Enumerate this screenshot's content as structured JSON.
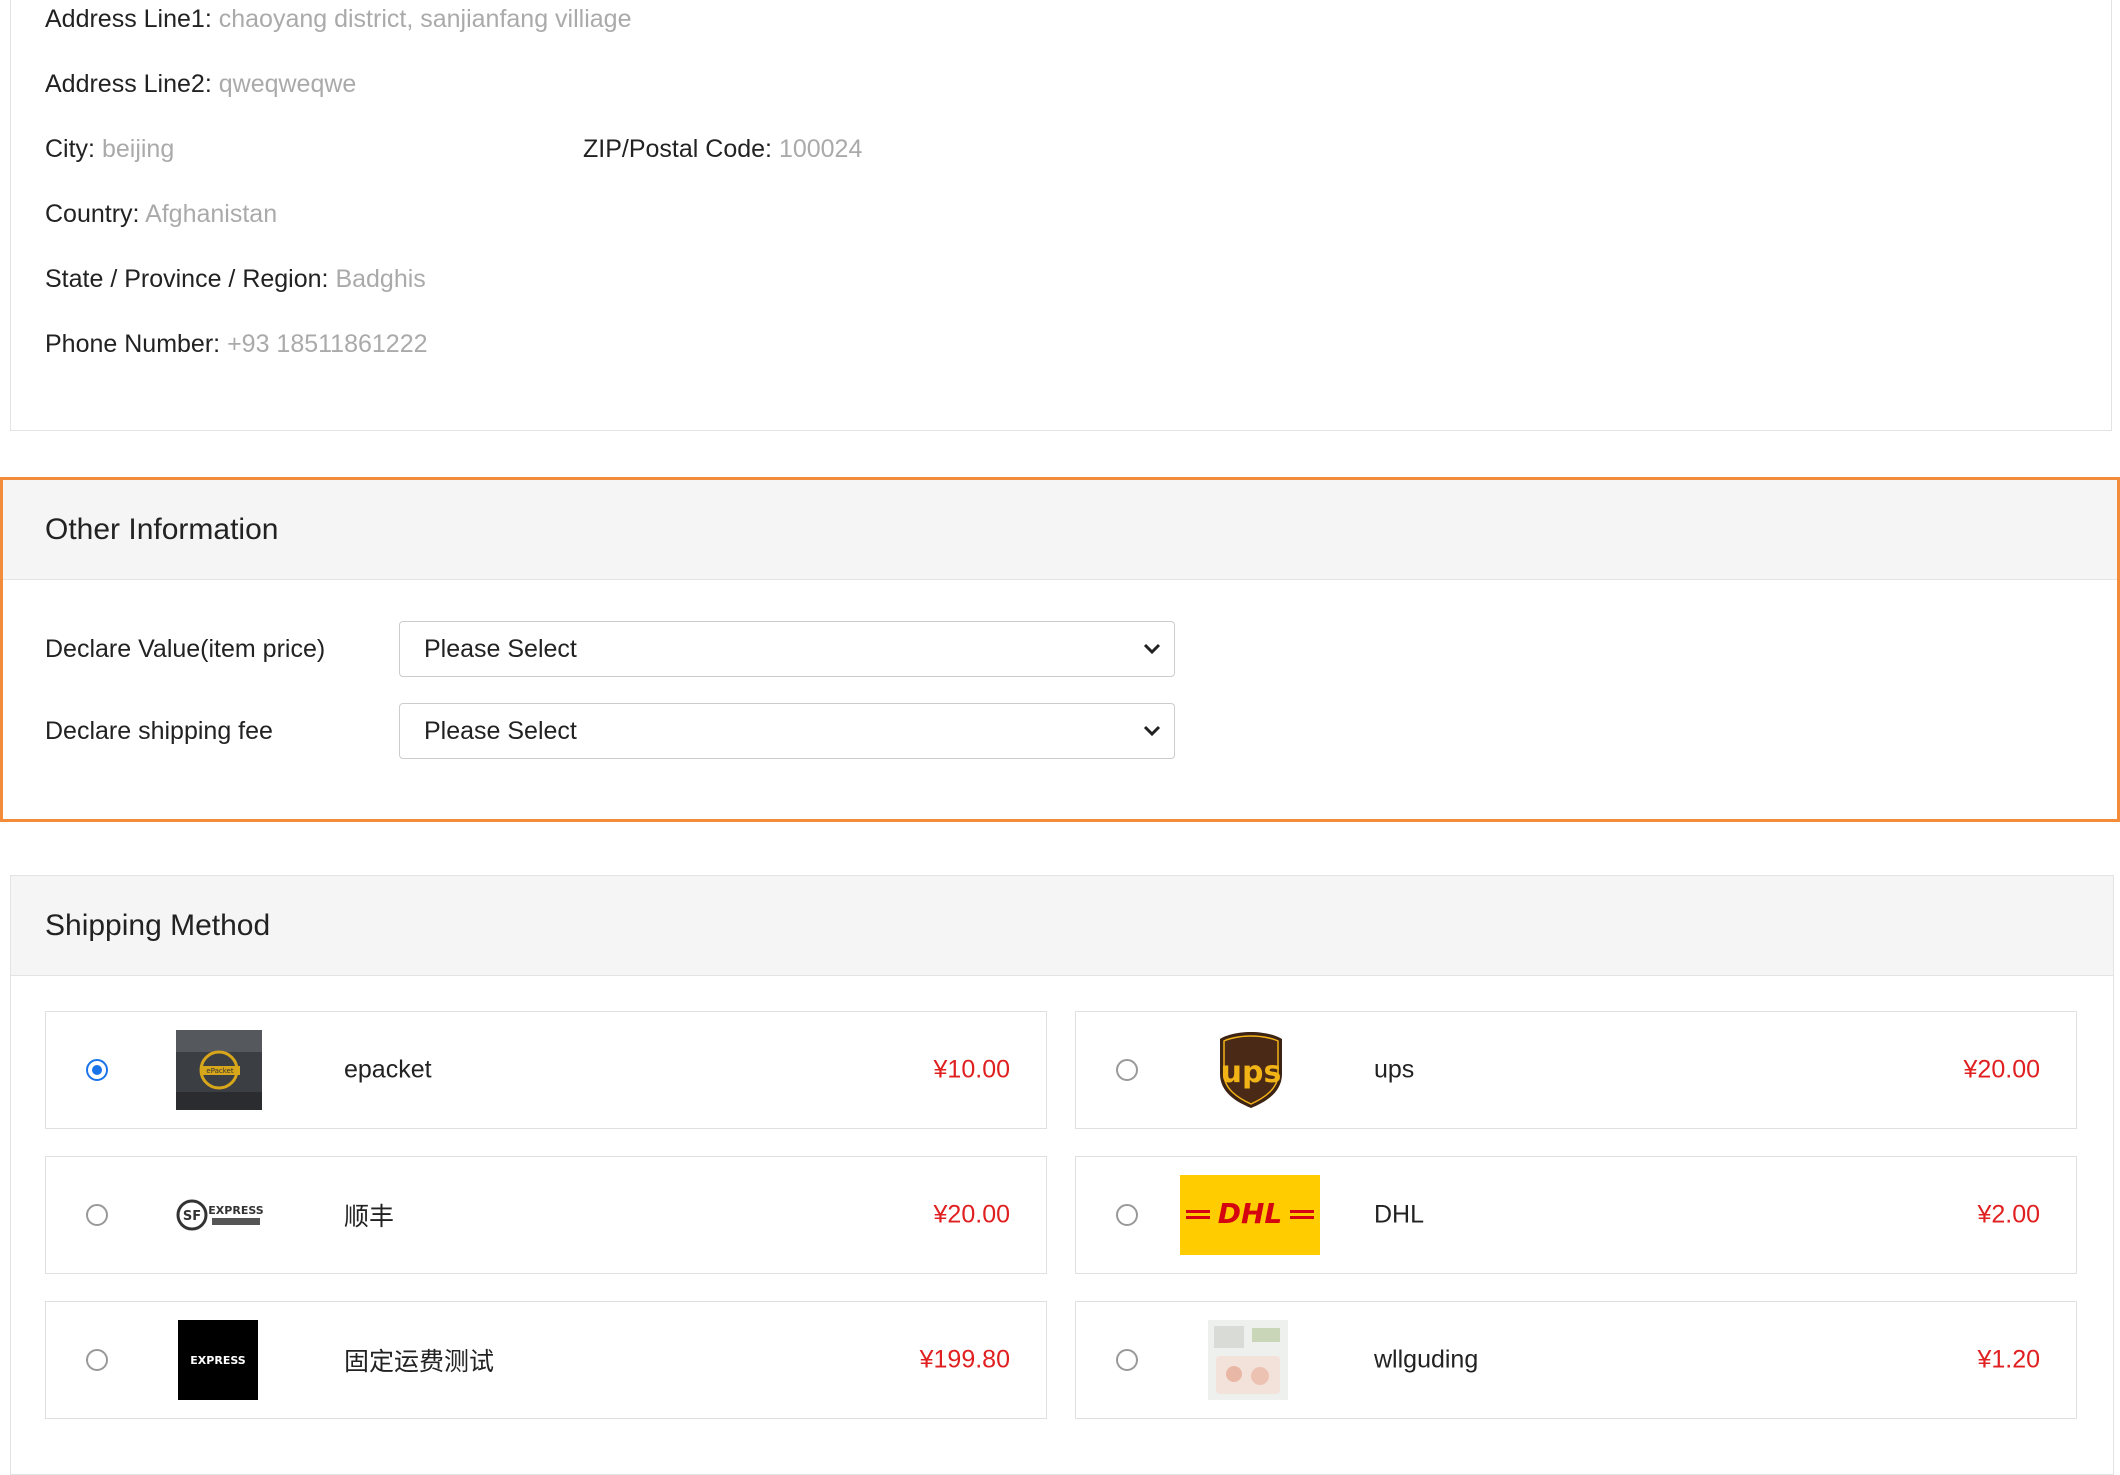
{
  "address": {
    "line1": {
      "label": "Address Line1:",
      "value": "chaoyang district, sanjianfang villiage"
    },
    "line2": {
      "label": "Address Line2:",
      "value": "qweqweqwe"
    },
    "city": {
      "label": "City:",
      "value": "beijing"
    },
    "zip": {
      "label": "ZIP/Postal Code:",
      "value": "100024"
    },
    "country": {
      "label": "Country:",
      "value": "Afghanistan"
    },
    "state": {
      "label": "State / Province / Region:",
      "value": "Badghis"
    },
    "phone": {
      "label": "Phone Number:",
      "value": "+93 18511861222"
    }
  },
  "other_info": {
    "title": "Other Information",
    "declare_value": {
      "label": "Declare Value(item price)",
      "selected": "Please Select"
    },
    "declare_fee": {
      "label": "Declare shipping fee",
      "selected": "Please Select"
    }
  },
  "shipping": {
    "title": "Shipping Method",
    "options": [
      {
        "name": "epacket",
        "price": "¥10.00",
        "checked": true,
        "logo_icon": "epacket-logo-icon",
        "logo_text": "ePacket"
      },
      {
        "name": "ups",
        "price": "¥20.00",
        "checked": false,
        "logo_icon": "ups-logo-icon",
        "logo_text": "ups"
      },
      {
        "name": "顺丰",
        "price": "¥20.00",
        "checked": false,
        "logo_icon": "sf-express-logo-icon",
        "logo_text": "SF EXPRESS"
      },
      {
        "name": "DHL",
        "price": "¥2.00",
        "checked": false,
        "logo_icon": "dhl-logo-icon",
        "logo_text": "DHL"
      },
      {
        "name": "固定运费测试",
        "price": "¥199.80",
        "checked": false,
        "logo_icon": "express-logo-icon",
        "logo_text": "EXPRESS"
      },
      {
        "name": "wllguding",
        "price": "¥1.20",
        "checked": false,
        "logo_icon": "product-photo-icon",
        "logo_text": ""
      }
    ]
  },
  "colors": {
    "highlight_border": "#f28b3a",
    "price": "#e02020",
    "radio_checked": "#1a73e8",
    "value_text": "#aaaaaa"
  }
}
